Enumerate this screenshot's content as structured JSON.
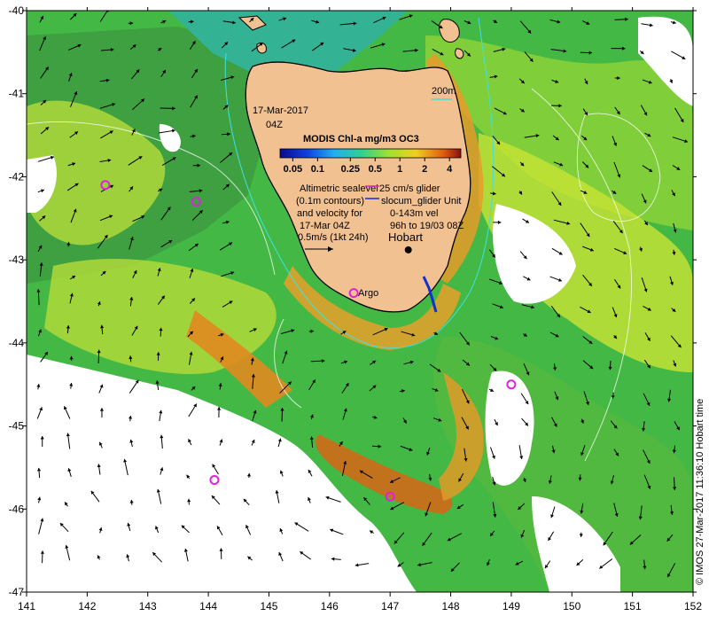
{
  "map": {
    "date": "17-Mar-2017",
    "time": "04Z",
    "colorbar_title": "MODIS Chl-a mg/m3 OC3",
    "colorbar_ticks": [
      "0.05",
      "0.1",
      "0.25",
      "0.5",
      "1",
      "2",
      "4"
    ],
    "contour_label": "200m",
    "legend_left": [
      "Altimetric sealevel",
      "(0.1m contours)",
      "and velocity for",
      "17-Mar 04Z"
    ],
    "scale_label": "0.5m/s (1kt 24h)",
    "legend_right": [
      "25 cm/s glider",
      "slocum_glider Unit",
      "0-143m vel",
      "96h to 19/03 08Z"
    ],
    "city_label": "Hobart",
    "argo_label": "Argo",
    "credit": "© IMOS 27-Mar-2017 11:36:10 Hobart time",
    "x_ticks": [
      "141",
      "142",
      "143",
      "144",
      "145",
      "146",
      "147",
      "148",
      "149",
      "150",
      "151",
      "152"
    ],
    "y_ticks": [
      "-40",
      "-41",
      "-42",
      "-43",
      "-44",
      "-45",
      "-46",
      "-47"
    ],
    "colors": {
      "land": "#f2c192",
      "green": "#2ea82e",
      "teal": "#33b393",
      "yellow": "#d8e830",
      "orange": "#e08a20",
      "argo": "#e020e0",
      "glider": "#1030d0"
    }
  },
  "chart_data": {
    "type": "heatmap",
    "xlabel": "",
    "ylabel": "",
    "xlim": [
      141,
      152
    ],
    "ylim": [
      -47,
      -40
    ],
    "argo_floats": [
      {
        "lon": 142.3,
        "lat": -42.1
      },
      {
        "lon": 143.8,
        "lat": -42.3
      },
      {
        "lon": 146.4,
        "lat": -43.4
      },
      {
        "lon": 149.0,
        "lat": -44.5
      },
      {
        "lon": 144.1,
        "lat": -45.65
      },
      {
        "lon": 147.0,
        "lat": -45.85
      }
    ],
    "hobart": {
      "lon": 147.3,
      "lat": -42.88
    }
  }
}
